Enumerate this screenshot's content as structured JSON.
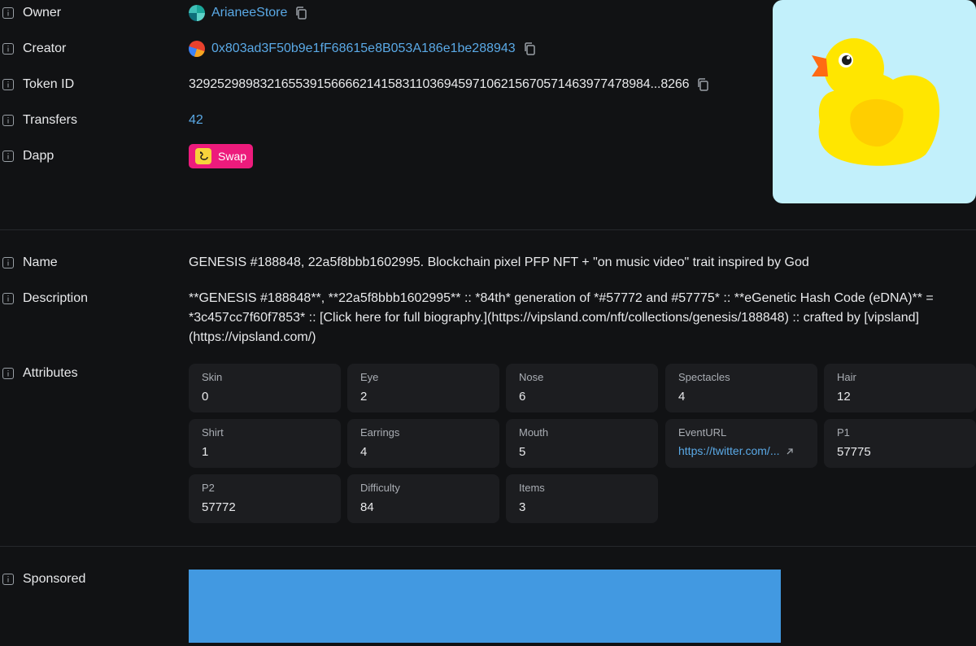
{
  "details": {
    "owner": {
      "label": "Owner",
      "value": "ArianeeStore"
    },
    "creator": {
      "label": "Creator",
      "value": "0x803ad3F50b9e1fF68615e8B053A186e1be288943"
    },
    "token_id": {
      "label": "Token ID",
      "value": "329252989832165539156666214158311036945971062156705714639774789​84...8266"
    },
    "transfers": {
      "label": "Transfers",
      "value": "42"
    },
    "dapp": {
      "label": "Dapp",
      "value": "Swap"
    }
  },
  "metadata": {
    "name": {
      "label": "Name",
      "value": "GENESIS #188848, 22a5f8bbb1602995. Blockchain pixel PFP NFT + \"on music video\" trait inspired by God"
    },
    "description": {
      "label": "Description",
      "value": "**GENESIS #188848**, **22a5f8bbb1602995** :: *84th* generation of *#57772 and #57775* :: **eGenetic Hash Code (eDNA)** = *3c457cc7f60f7853* :: [Click here for full biography.](https://vipsland.com/nft/collections/genesis/188848) :: crafted by [vipsland](https://vipsland.com/)"
    },
    "attributes_label": "Attributes",
    "attributes": [
      {
        "name": "Skin",
        "value": "0"
      },
      {
        "name": "Eye",
        "value": "2"
      },
      {
        "name": "Nose",
        "value": "6"
      },
      {
        "name": "Spectacles",
        "value": "4"
      },
      {
        "name": "Hair",
        "value": "12"
      },
      {
        "name": "Shirt",
        "value": "1"
      },
      {
        "name": "Earrings",
        "value": "4"
      },
      {
        "name": "Mouth",
        "value": "5"
      },
      {
        "name": "EventURL",
        "value": "https://twitter.com/..."
      },
      {
        "name": "P1",
        "value": "57775"
      },
      {
        "name": "P2",
        "value": "57772"
      },
      {
        "name": "Difficulty",
        "value": "84"
      },
      {
        "name": "Items",
        "value": "3"
      }
    ]
  },
  "sponsored": {
    "label": "Sponsored"
  },
  "colors": {
    "background": "#111214",
    "link": "#5aa9e6",
    "dapp_button": "#ed1b7c",
    "card": "#1c1d20",
    "image_bg": "#c2f0fb",
    "ad_box": "#4299e1"
  },
  "icons": {
    "info": "info-icon",
    "copy": "copy-icon",
    "external": "arrow-up-right-icon"
  }
}
